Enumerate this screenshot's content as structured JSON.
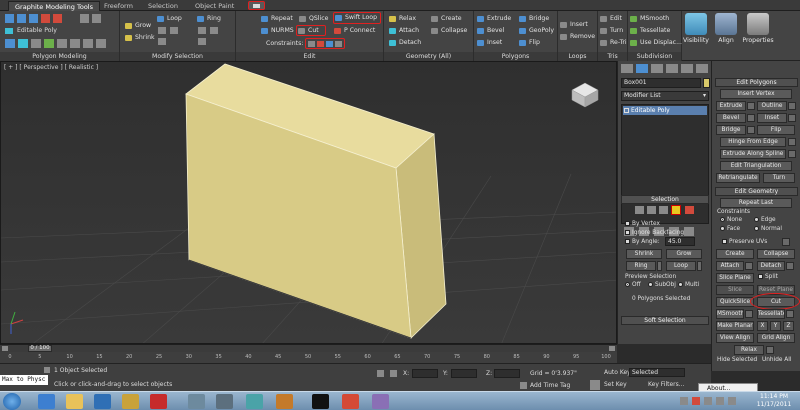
{
  "ribbon_tabs": [
    "Graphite Modeling Tools",
    "Freeform",
    "Selection",
    "Object Paint"
  ],
  "ribbon": {
    "group_polygon_modeling": {
      "label": "Polygon Modeling",
      "object_type": "Editable Poly"
    },
    "group_modify_selection": {
      "label": "Modify Selection",
      "grow": "Grow",
      "shrink": "Shrink",
      "loop": "Loop",
      "ring": "Ring"
    },
    "group_edit": {
      "label": "Edit",
      "repeat": "Repeat",
      "qslice": "QSlice",
      "swift_loop": "Swift Loop",
      "nurms": "NURMS",
      "cut": "Cut",
      "p_connect": "P Connect",
      "constraints": "Constraints:"
    },
    "group_geometry": {
      "label": "Geometry (All)",
      "relax": "Relax",
      "create": "Create",
      "attach": "Attach",
      "collapse": "Collapse",
      "detach": "Detach"
    },
    "group_polygons": {
      "label": "Polygons",
      "extrude": "Extrude",
      "bridge": "Bridge",
      "bevel": "Bevel",
      "geopoly": "GeoPoly",
      "inset": "Inset",
      "flip": "Flip"
    },
    "group_loops": {
      "label": "Loops",
      "insert": "Insert",
      "remove": "Remove"
    },
    "group_tris": {
      "label": "Tris",
      "edit": "Edit",
      "turn": "Turn",
      "retri": "Re-Tri"
    },
    "group_subdivision": {
      "label": "Subdivision",
      "msmooth": "MSmooth",
      "tessellate": "Tessellate",
      "use_displace": "Use Displac..."
    },
    "visibility": "Visibility",
    "align": "Align",
    "properties": "Properties"
  },
  "viewport": {
    "label": "[ + ] [ Perspective ] [ Realistic ]"
  },
  "command_panel": {
    "object_name": "Box001",
    "modifier_list": "Modifier List",
    "stack_item": "Editable Poly",
    "selection_title": "Selection",
    "by_vertex": "By Vertex",
    "ignore_backfacing": "Ignore Backfacing",
    "by_angle": "By Angle:",
    "angle_value": "45.0",
    "shrink": "Shrink",
    "grow": "Grow",
    "ring": "Ring",
    "loop": "Loop",
    "preview_selection": "Preview Selection",
    "off": "Off",
    "subobj": "SubObj",
    "multi": "Multi",
    "polygons_selected": "0 Polygons Selected",
    "soft_selection": "Soft Selection"
  },
  "right_panel": {
    "edit_polygons_title": "Edit Polygons",
    "insert_vertex": "Insert Vertex",
    "extrude": "Extrude",
    "outline": "Outline",
    "bevel": "Bevel",
    "inset": "Inset",
    "bridge": "Bridge",
    "flip": "Flip",
    "hinge_from_edge": "Hinge From Edge",
    "extrude_along_spline": "Extrude Along Spline",
    "edit_triangulation": "Edit Triangulation",
    "retriangulate": "Retriangulate",
    "turn": "Turn",
    "edit_geometry_title": "Edit Geometry",
    "repeat_last": "Repeat Last",
    "constraints": "Constraints",
    "none": "None",
    "edge": "Edge",
    "face": "Face",
    "normal": "Normal",
    "preserve_uvs": "Preserve UVs",
    "create": "Create",
    "collapse": "Collapse",
    "attach": "Attach",
    "detach": "Detach",
    "slice_plane": "Slice Plane",
    "split": "Split",
    "slice": "Slice",
    "reset_plane": "Reset Plane",
    "quickslice": "QuickSlice",
    "cut": "Cut",
    "msmooth": "MSmooth",
    "tessellate": "Tessellate",
    "make_planar": "Make Planar",
    "x": "X",
    "y": "Y",
    "z": "Z",
    "view_align": "View Align",
    "grid_align": "Grid Align",
    "relax": "Relax",
    "hide_selected": "Hide Selected",
    "unhide_all": "Unhide All"
  },
  "timeline": {
    "frame": "0 / 100",
    "ticks": [
      "0",
      "5",
      "10",
      "15",
      "20",
      "25",
      "30",
      "35",
      "40",
      "45",
      "50",
      "55",
      "60",
      "65",
      "70",
      "75",
      "80",
      "85",
      "90",
      "95",
      "100"
    ]
  },
  "status": {
    "script_box": "Max to Physc",
    "objects_selected": "1 Object Selected",
    "prompt": "Click or click-and-drag to select objects",
    "x_label": "X:",
    "y_label": "Y:",
    "z_label": "Z:",
    "grid": "Grid = 0'3.937\"",
    "add_time_tag": "Add Time Tag",
    "auto_key": "Auto Key",
    "selected": "Selected",
    "set_key": "Set Key",
    "key_filters": "Key Filters...",
    "about": "About..."
  },
  "taskbar": {
    "time": "11:14 PM",
    "date": "11/17/2011"
  }
}
